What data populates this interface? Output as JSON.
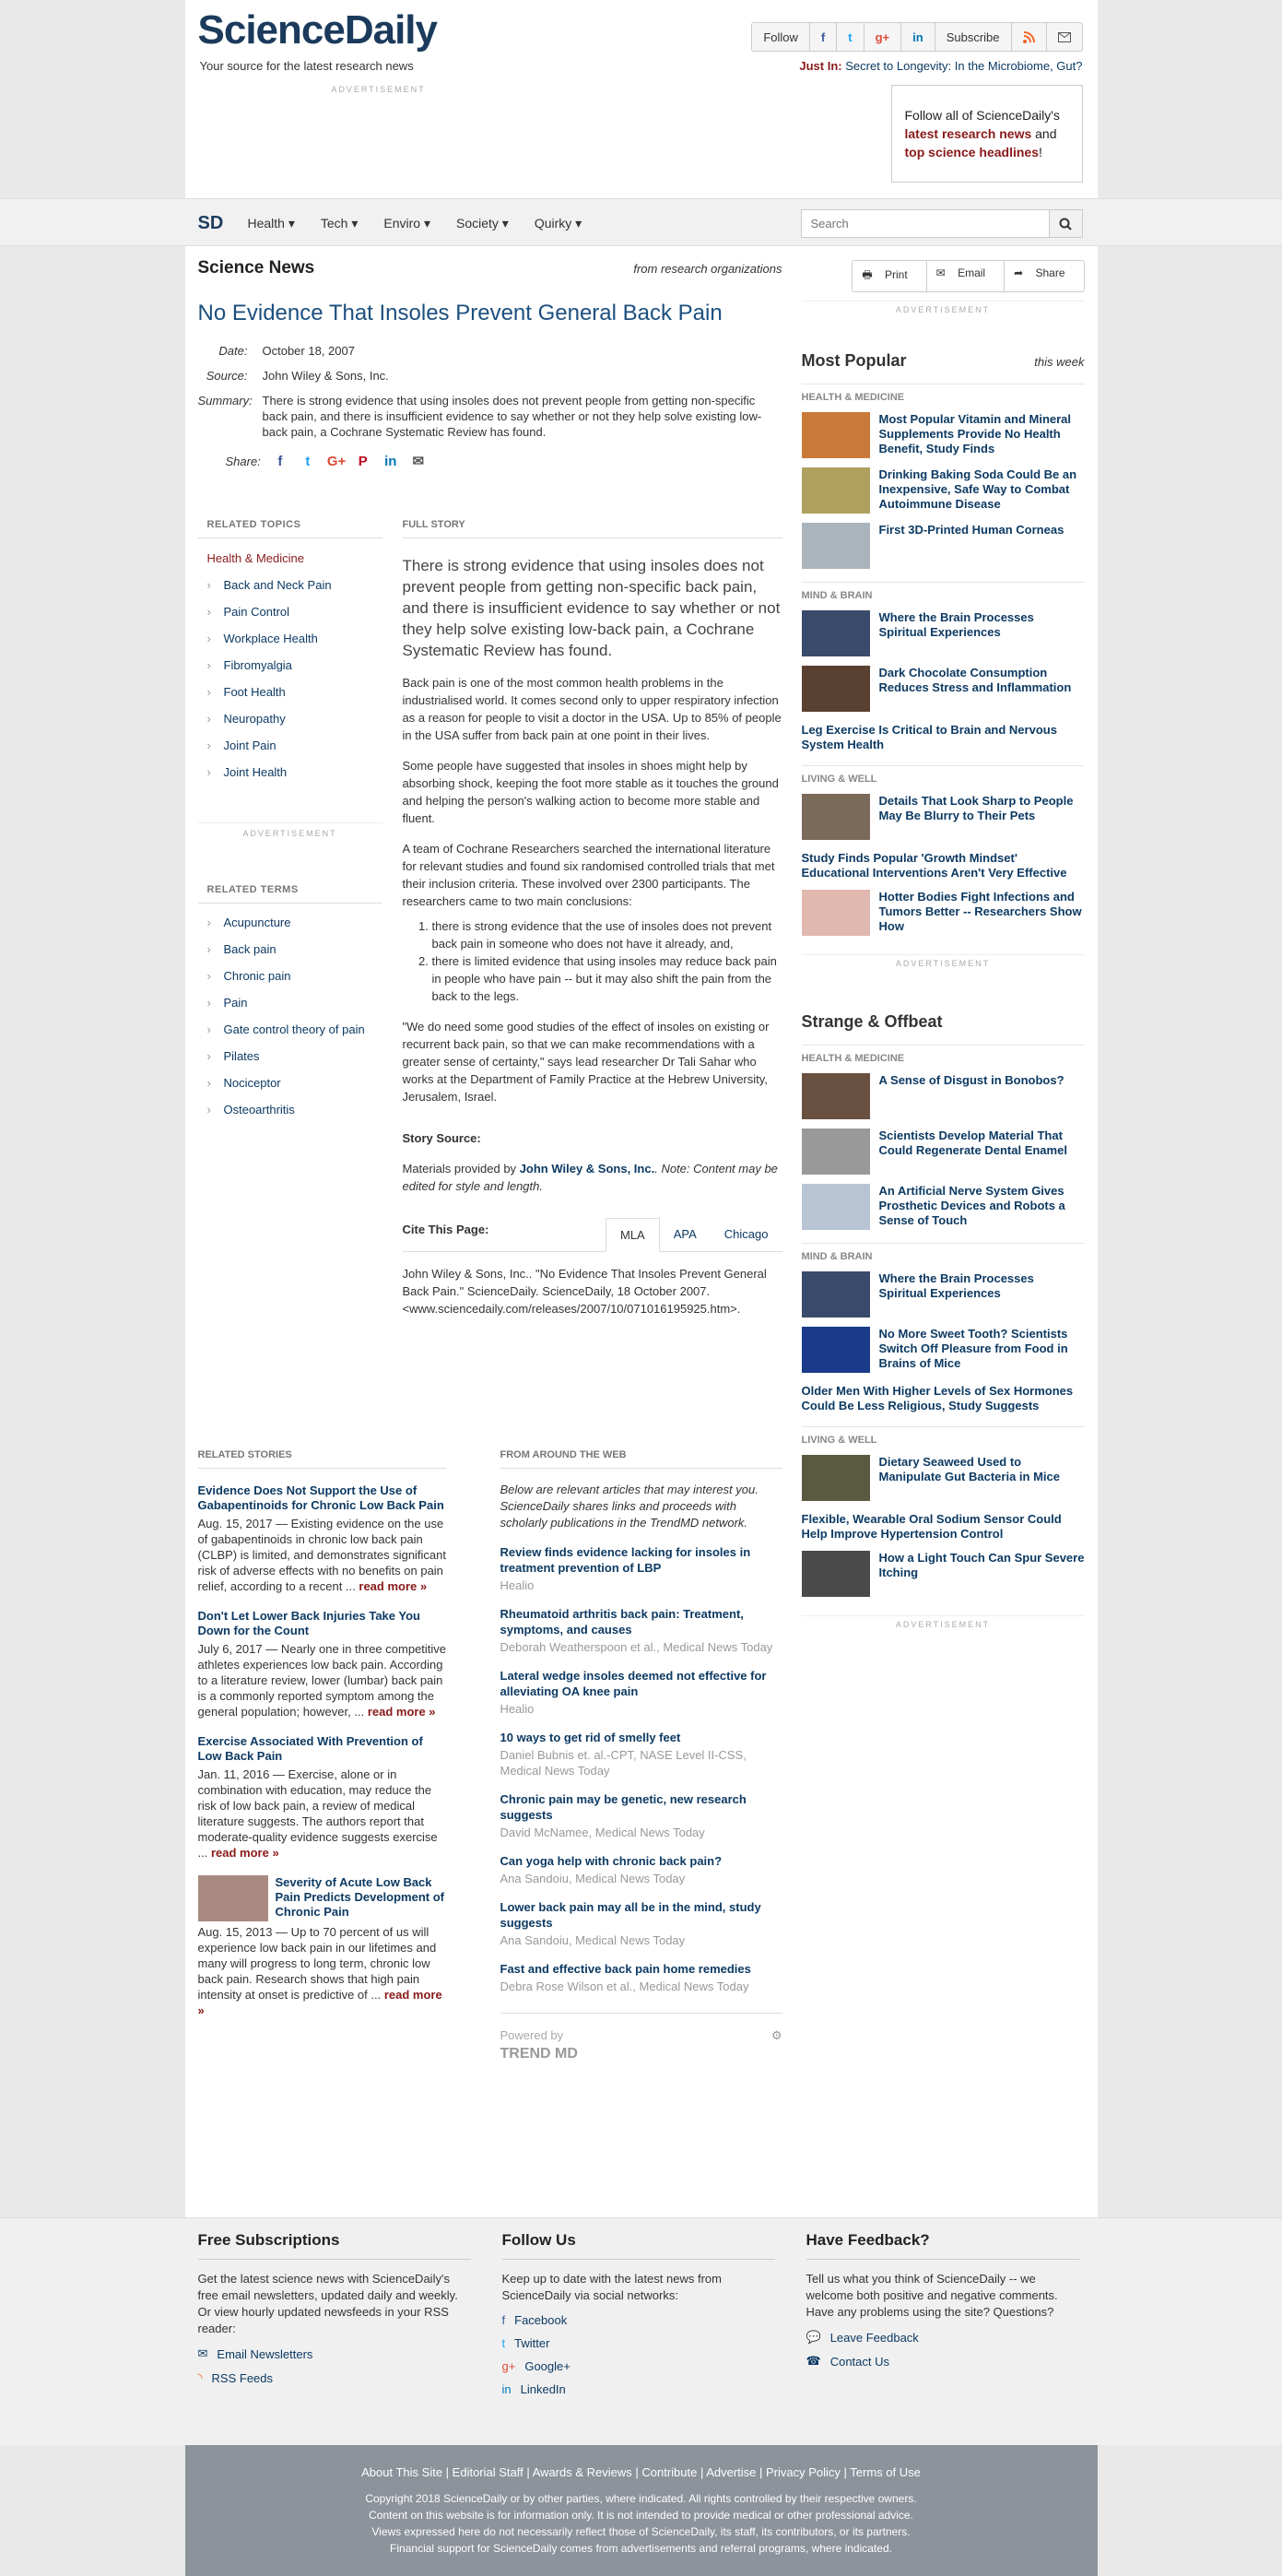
{
  "header": {
    "logo": "ScienceDaily",
    "tagline": "Your source for the latest research news",
    "buttons": [
      "Follow",
      "f",
      "t",
      "g+",
      "in",
      "Subscribe",
      "rss",
      "mail"
    ],
    "just_in_label": "Just In:",
    "just_in": "Secret to Longevity: In the Microbiome, Gut?",
    "ad": "ADVERTISEMENT",
    "follow_box": {
      "pre": "Follow all of ScienceDaily's",
      "b1": "latest research news",
      "mid": "and",
      "b2": "top science headlines",
      "post": "!"
    }
  },
  "nav": {
    "logo": "SD",
    "items": [
      "Health ▾",
      "Tech ▾",
      "Enviro ▾",
      "Society ▾",
      "Quirky ▾"
    ],
    "search_placeholder": "Search"
  },
  "article": {
    "section": "Science News",
    "from": "from research organizations",
    "title": "No Evidence That Insoles Prevent General Back Pain",
    "date_label": "Date:",
    "date": "October 18, 2007",
    "source_label": "Source:",
    "source": "John Wiley & Sons, Inc.",
    "summary_label": "Summary:",
    "summary": "There is strong evidence that using insoles does not prevent people from getting non-specific back pain, and there is insufficient evidence to say whether or not they help solve existing low-back pain, a Cochrane Systematic Review has found.",
    "share_label": "Share:",
    "full_story": "FULL STORY",
    "lead": "There is strong evidence that using insoles does not prevent people from getting non-specific back pain, and there is insufficient evidence to say whether or not they help solve existing low-back pain, a Cochrane Systematic Review has found.",
    "p1": "Back pain is one of the most common health problems in the industrialised world. It comes second only to upper respiratory infection as a reason for people to visit a doctor in the USA. Up to 85% of people in the USA suffer from back pain at one point in their lives.",
    "p2": "Some people have suggested that insoles in shoes might help by absorbing shock, keeping the foot more stable as it touches the ground and helping the person's walking action to become more stable and fluent.",
    "p3": "A team of Cochrane Researchers searched the international literature for relevant studies and found six randomised controlled trials that met their inclusion criteria. These involved over 2300 participants. The researchers came to two main conclusions:",
    "li1": "there is strong evidence that the use of insoles does not prevent back pain in someone who does not have it already, and,",
    "li2": "there is limited evidence that using insoles may reduce back pain in people who have pain -- but it may also shift the pain from the back to the legs.",
    "p4": "\"We do need some good studies of the effect of insoles on existing or recurrent back pain, so that we can make recommendations with a greater sense of certainty,\" says lead researcher Dr Tali Sahar who works at the Department of Family Practice at the Hebrew University, Jerusalem, Israel.",
    "story_source_label": "Story Source:",
    "story_source_pre": "Materials provided by",
    "story_source_link": "John Wiley & Sons, Inc.",
    "story_source_note": ". Note: Content may be edited for style and length.",
    "cite_label": "Cite This Page:",
    "cite_tabs": [
      "MLA",
      "APA",
      "Chicago"
    ],
    "cite_text": "John Wiley & Sons, Inc.. \"No Evidence That Insoles Prevent General Back Pain.\" ScienceDaily. ScienceDaily, 18 October 2007. <www.sciencedaily.com/releases/2007/10/071016195925.htm>."
  },
  "related_topics": {
    "heading": "RELATED TOPICS",
    "category": "Health & Medicine",
    "items": [
      "Back and Neck Pain",
      "Pain Control",
      "Workplace Health",
      "Fibromyalgia",
      "Foot Health",
      "Neuropathy",
      "Joint Pain",
      "Joint Health"
    ]
  },
  "related_terms": {
    "heading": "RELATED TERMS",
    "items": [
      "Acupuncture",
      "Back pain",
      "Chronic pain",
      "Pain",
      "Gate control theory of pain",
      "Pilates",
      "Nociceptor",
      "Osteoarthritis"
    ]
  },
  "toolbar": [
    "Print",
    "Email",
    "Share"
  ],
  "most_popular": {
    "title": "Most Popular",
    "when": "this week",
    "cats": [
      "HEALTH & MEDICINE",
      "MIND & BRAIN",
      "LIVING & WELL"
    ],
    "items": [
      "Most Popular Vitamin and Mineral Supplements Provide No Health Benefit, Study Finds",
      "Drinking Baking Soda Could Be an Inexpensive, Safe Way to Combat Autoimmune Disease",
      "First 3D-Printed Human Corneas",
      "Where the Brain Processes Spiritual Experiences",
      "Dark Chocolate Consumption Reduces Stress and Inflammation",
      "Leg Exercise Is Critical to Brain and Nervous System Health",
      "Details That Look Sharp to People May Be Blurry to Their Pets",
      "Study Finds Popular 'Growth Mindset' Educational Interventions Aren't Very Effective",
      "Hotter Bodies Fight Infections and Tumors Better -- Researchers Show How"
    ]
  },
  "strange": {
    "title": "Strange & Offbeat",
    "cats": [
      "HEALTH & MEDICINE",
      "MIND & BRAIN",
      "LIVING & WELL"
    ],
    "items": [
      "A Sense of Disgust in Bonobos?",
      "Scientists Develop Material That Could Regenerate Dental Enamel",
      "An Artificial Nerve System Gives Prosthetic Devices and Robots a Sense of Touch",
      "Where the Brain Processes Spiritual Experiences",
      "No More Sweet Tooth? Scientists Switch Off Pleasure from Food in Brains of Mice",
      "Older Men With Higher Levels of Sex Hormones Could Be Less Religious, Study Suggests",
      "Dietary Seaweed Used to Manipulate Gut Bacteria in Mice",
      "Flexible, Wearable Oral Sodium Sensor Could Help Improve Hypertension Control",
      "How a Light Touch Can Spur Severe Itching"
    ]
  },
  "related_stories": {
    "heading": "RELATED STORIES",
    "read_more": "read more »",
    "items": [
      {
        "title": "Evidence Does Not Support the Use of Gabapentinoids for Chronic Low Back Pain",
        "desc": "Aug. 15, 2017 — Existing evidence on the use of gabapentinoids in chronic low back pain (CLBP) is limited, and demonstrates significant risk of adverse effects with no benefits on pain relief, according to a recent ..."
      },
      {
        "title": "Don't Let Lower Back Injuries Take You Down for the Count",
        "desc": "July 6, 2017 — Nearly one in three competitive athletes experiences low back pain. According to a literature review, lower (lumbar) back pain is a commonly reported symptom among the general population; however, ..."
      },
      {
        "title": "Exercise Associated With Prevention of Low Back Pain",
        "desc": "Jan. 11, 2016 — Exercise, alone or in combination with education, may reduce the risk of low back pain, a review of medical literature suggests. The authors report that moderate-quality evidence suggests exercise ..."
      },
      {
        "title": "Severity of Acute Low Back Pain Predicts Development of Chronic Pain",
        "desc": "Aug. 15, 2013 — Up to 70 percent of us will experience low back pain in our lifetimes and many will progress to long term, chronic low back pain. Research shows that high pain intensity at onset is predictive of ..."
      }
    ]
  },
  "around_web": {
    "heading": "FROM AROUND THE WEB",
    "intro": "Below are relevant articles that may interest you. ScienceDaily shares links and proceeds with scholarly publications in the TrendMD network.",
    "items": [
      {
        "t": "Review finds evidence lacking for insoles in treatment prevention of LBP",
        "s": "Healio"
      },
      {
        "t": "Rheumatoid arthritis back pain: Treatment, symptoms, and causes",
        "s": "Deborah Weatherspoon et al., Medical News Today"
      },
      {
        "t": "Lateral wedge insoles deemed not effective for alleviating OA knee pain",
        "s": "Healio"
      },
      {
        "t": "10 ways to get rid of smelly feet",
        "s": "Daniel Bubnis et. al.-CPT, NASE Level II-CSS, Medical News Today"
      },
      {
        "t": "Chronic pain may be genetic, new research suggests",
        "s": "David McNamee, Medical News Today"
      },
      {
        "t": "Can yoga help with chronic back pain?",
        "s": "Ana Sandoiu, Medical News Today"
      },
      {
        "t": "Lower back pain may all be in the mind, study suggests",
        "s": "Ana Sandoiu, Medical News Today"
      },
      {
        "t": "Fast and effective back pain home remedies",
        "s": "Debra Rose Wilson et al., Medical News Today"
      }
    ],
    "powered": "Powered by",
    "brand": "TREND MD"
  },
  "footer": {
    "sub_title": "Free Subscriptions",
    "sub_text": "Get the latest science news with ScienceDaily's free email newsletters, updated daily and weekly. Or view hourly updated newsfeeds in your RSS reader:",
    "sub_links": [
      "Email Newsletters",
      "RSS Feeds"
    ],
    "follow_title": "Follow Us",
    "follow_text": "Keep up to date with the latest news from ScienceDaily via social networks:",
    "follow_links": [
      "Facebook",
      "Twitter",
      "Google+",
      "LinkedIn"
    ],
    "fb_title": "Have Feedback?",
    "fb_text": "Tell us what you think of ScienceDaily -- we welcome both positive and negative comments. Have any problems using the site? Questions?",
    "fb_links": [
      "Leave Feedback",
      "Contact Us"
    ],
    "links": "About This Site | Editorial Staff | Awards & Reviews | Contribute | Advertise | Privacy Policy | Terms of Use",
    "copy1": "Copyright 2018 ScienceDaily or by other parties, where indicated. All rights controlled by their respective owners.",
    "copy2": "Content on this website is for information only. It is not intended to provide medical or other professional advice.",
    "copy3": "Views expressed here do not necessarily reflect those of ScienceDaily, its staff, its contributors, or its partners.",
    "copy4": "Financial support for ScienceDaily comes from advertisements and referral programs, where indicated."
  }
}
